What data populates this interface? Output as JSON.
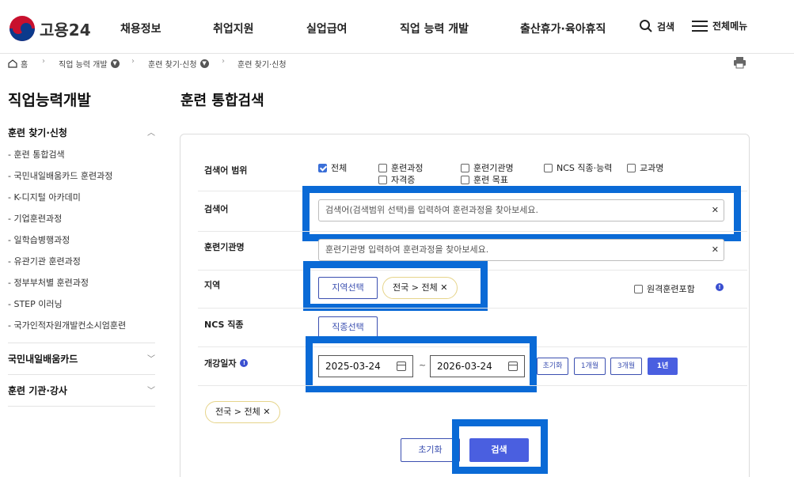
{
  "header": {
    "logo_text": "고용24",
    "nav": [
      "채용정보",
      "취업지원",
      "실업급여",
      "직업 능력 개발",
      "출산휴가·육아휴직"
    ],
    "search_label": "검색",
    "menu_label": "전체메뉴"
  },
  "breadcrumb": {
    "home": "홈",
    "items": [
      "직업 능력 개발",
      "훈련 찾기·신청",
      "훈련 찾기·신청"
    ]
  },
  "sidebar": {
    "title": "직업능력개발",
    "group1": "훈련 찾기·신청",
    "items": [
      "- 훈련 통합검색",
      "- 국민내일배움카드 훈련과정",
      "- K-디지털 아카데미",
      "- 기업훈련과정",
      "- 일학습병행과정",
      "- 유관기관 훈련과정",
      "- 정부부처별 훈련과정",
      "- STEP 이러닝",
      "- 국가인적자원개발컨소시엄훈련"
    ],
    "group2": "국민내일배움카드",
    "group3": "훈련 기관·강사"
  },
  "main": {
    "title": "훈련 통합검색",
    "scope_label": "검색어 범위",
    "scope_options": [
      {
        "label": "전체",
        "checked": true
      },
      {
        "label": "훈련과정",
        "checked": false
      },
      {
        "label": "훈련기관명",
        "checked": false
      },
      {
        "label": "NCS 직종·능력",
        "checked": false
      },
      {
        "label": "교과명",
        "checked": false
      },
      {
        "label": "자격증",
        "checked": false
      },
      {
        "label": "훈련 목표",
        "checked": false
      }
    ],
    "keyword_label": "검색어",
    "keyword_placeholder": "검색어(검색범위 선택)를 입력하여 훈련과정을 찾아보세요.",
    "org_label": "훈련기관명",
    "org_placeholder": "훈련기관명 입력하여 훈련과정을 찾아보세요.",
    "region_label": "지역",
    "region_button": "지역선택",
    "region_chip": "전국 > 전체",
    "remote_label": "원격훈련포함",
    "ncs_label": "NCS 직종",
    "ncs_button": "직종선택",
    "date_label": "개강일자",
    "date_start": "2025-03-24",
    "date_end": "2026-03-24",
    "date_sep": "~",
    "period_buttons": [
      "초기화",
      "1개월",
      "3개월",
      "1년"
    ],
    "period_selected": "1년",
    "summary_chip": "전국 > 전체",
    "reset_button": "초기화",
    "search_button": "검색"
  },
  "colors": {
    "accent": "#4a5fe0",
    "highlight": "#0a6ad6",
    "chip_border": "#e6d48a"
  }
}
